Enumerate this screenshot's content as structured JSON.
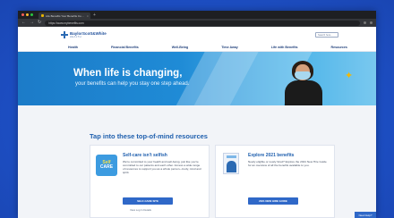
{
  "browser": {
    "tab_title": "Life Benefits Your Benefits Co…",
    "tab_close": "×",
    "new_tab": "+",
    "url": "https://www.mybenefits.com"
  },
  "site": {
    "logo_name": "BaylorScott&White",
    "logo_sub": "HEALTH",
    "search_placeholder": "Search here..."
  },
  "nav": {
    "items": [
      "Health",
      "Financial Benefits",
      "Well-Being",
      "Time Away",
      "Life with Benefits",
      "Resources"
    ]
  },
  "hero": {
    "title": "When life is changing,",
    "subtitle": "your benefits can help you stay one step ahead."
  },
  "resources": {
    "title": "Tap into these top-of-mind resources",
    "cards": [
      {
        "art_line1": "Self",
        "art_line2": "CARE",
        "heading": "Self-care isn't selfish",
        "body": "We're committed to your health and well-being, just like you're committed to our patients and each other. Access a wide range of resources to support you as a whole person—body, mind and spirit.",
        "button": "SELF-CARE SITE",
        "link": "View Log In Details"
      },
      {
        "heading": "Explore 2021 benefits",
        "body": "Newly eligible or newly hired? Explore the 2021 New Hire Guide for an overview of all the benefits available to you.",
        "button": "2021 NEW HIRE GUIDE"
      }
    ]
  },
  "chat": {
    "label": "Need Help?"
  },
  "colors": {
    "accent": "#2f68c8",
    "hero": "#1f8bd6",
    "background": "#1f52c9"
  }
}
